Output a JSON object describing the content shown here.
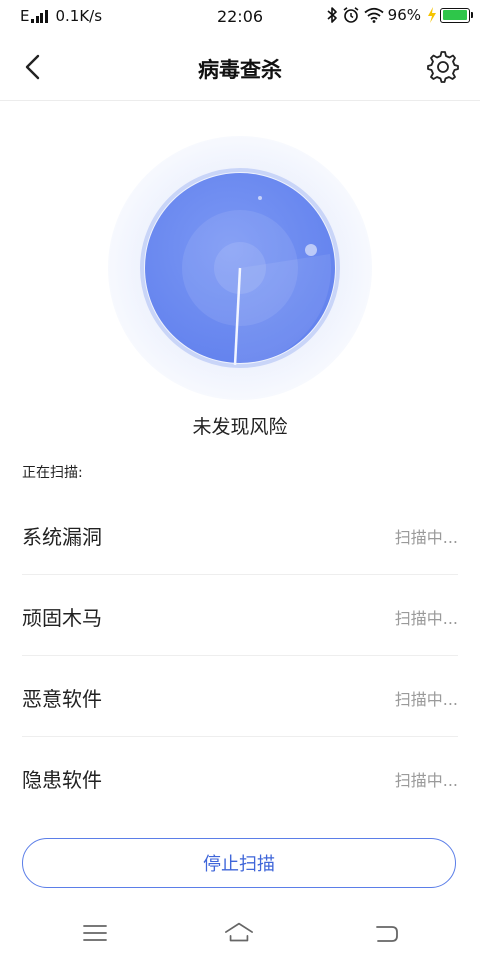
{
  "status_bar": {
    "carrier": "E",
    "net_speed": "0.1K/s",
    "time": "22:06",
    "battery_percent": "96%",
    "battery_level": 0.96,
    "icons": [
      "signal-icon",
      "bluetooth-icon",
      "alarm-icon",
      "wifi-icon",
      "charging-icon",
      "battery-icon"
    ]
  },
  "header": {
    "title": "病毒查杀",
    "back_icon": "back-arrow-icon",
    "settings_icon": "gear-icon"
  },
  "scan": {
    "status_text": "未发现风险",
    "scanning_label": "正在扫描:",
    "items": [
      {
        "name": "系统漏洞",
        "status": "扫描中..."
      },
      {
        "name": "顽固木马",
        "status": "扫描中..."
      },
      {
        "name": "恶意软件",
        "status": "扫描中..."
      },
      {
        "name": "隐患软件",
        "status": "扫描中..."
      }
    ],
    "stop_label": "停止扫描"
  },
  "colors": {
    "accent": "#5b7ee8",
    "radar_fill": "#6f8ff2",
    "muted_text": "#9a9a9a"
  },
  "system_nav": {
    "icons": [
      "menu-icon",
      "home-icon",
      "back-icon"
    ]
  }
}
